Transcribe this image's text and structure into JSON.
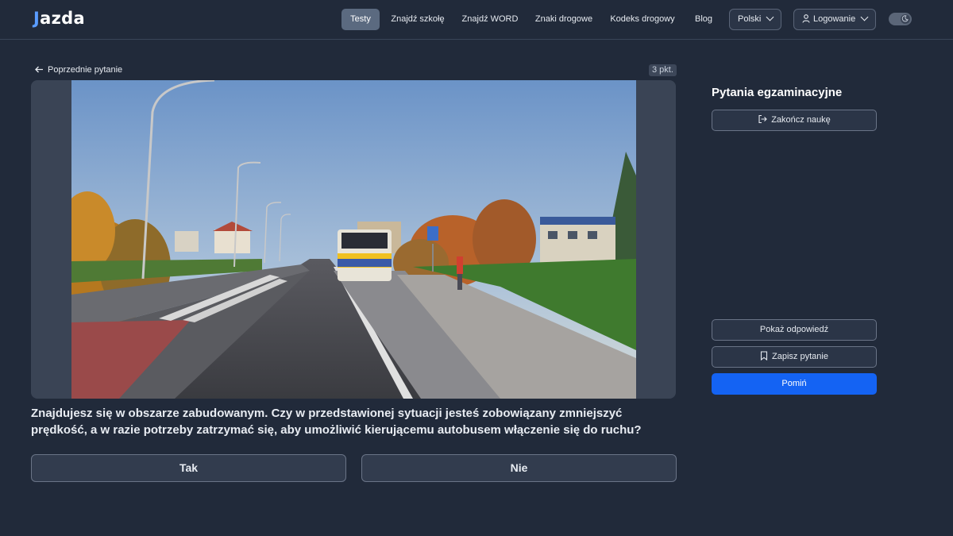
{
  "header": {
    "logo": "azda",
    "nav": [
      {
        "label": "Testy",
        "active": true
      },
      {
        "label": "Znajdź szkołę",
        "active": false
      },
      {
        "label": "Znajdź WORD",
        "active": false
      },
      {
        "label": "Znaki drogowe",
        "active": false
      },
      {
        "label": "Kodeks drogowy",
        "active": false
      },
      {
        "label": "Blog",
        "active": false
      }
    ],
    "language": "Polski",
    "login": "Logowanie",
    "theme_toggle_icon": "moon-icon"
  },
  "question_panel": {
    "back_label": "Poprzednie pytanie",
    "points": "3 pkt.",
    "question_text": "Znajdujesz się w obszarze zabudowanym. Czy w przedstawionej sytuacji jesteś zobowiązany zmniejszyć prędkość, a w razie potrzeby zatrzymać się, aby umożliwić kierującemu autobusem włączenie się do ruchu?",
    "answers": [
      "Tak",
      "Nie"
    ]
  },
  "sidebar": {
    "title": "Pytania egzaminacyjne",
    "end_button": "Zakończ naukę",
    "show_answer_button": "Pokaż odpowiedź",
    "save_button": "Zapisz pytanie",
    "skip_button": "Pomiń"
  },
  "colors": {
    "background": "#212a3a",
    "primary": "#1463f3",
    "active_nav": "#5b6a80"
  }
}
